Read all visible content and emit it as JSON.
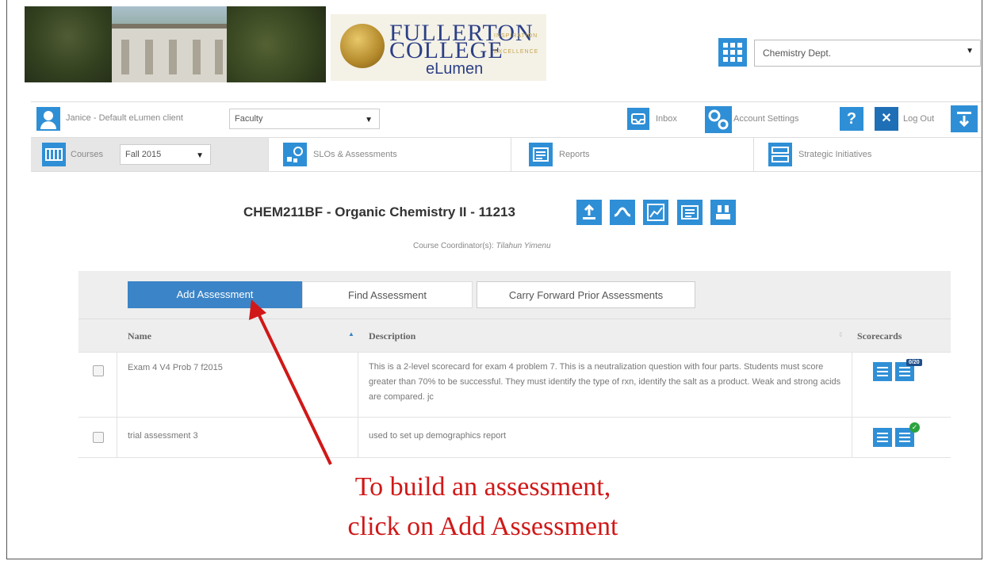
{
  "header": {
    "logo_line1": "FULLERTON",
    "logo_line2": "COLLEGE",
    "logo_tag1": "INSPIRATION",
    "logo_tag2": "EXCELLENCE",
    "logo_sub": "eLumen",
    "department": "Chemistry Dept."
  },
  "userbar": {
    "user_label": "Janice - Default eLumen client",
    "role": "Faculty",
    "inbox": "Inbox",
    "account_settings": "Account Settings",
    "help": "?",
    "logout_x": "✕",
    "logout": "Log Out"
  },
  "nav": {
    "courses": "Courses",
    "term": "Fall 2015",
    "slos": "SLOs & Assessments",
    "reports": "Reports",
    "strategic": "Strategic Initiatives"
  },
  "course": {
    "title": "CHEM211BF - Organic Chemistry II - 11213",
    "coordinator_label": "Course Coordinator(s): ",
    "coordinator_name": "Tilahun Yimenu"
  },
  "actions": {
    "add": "Add Assessment",
    "find": "Find Assessment",
    "carry": "Carry Forward Prior Assessments"
  },
  "table": {
    "columns": [
      "Name",
      "Description",
      "Scorecards"
    ],
    "rows": [
      {
        "name": "Exam 4 V4 Prob 7 f2015",
        "description": "This is a 2-level scorecard for exam 4 problem 7. This is a neutralization question with four parts. Students must score greater than 70% to be successful. They must identify the type of rxn, identify the salt as a product. Weak and strong acids are compared. jc",
        "badge": "0/20"
      },
      {
        "name": "trial assessment 3",
        "description": "used to set up demographics report",
        "badge": "✓"
      }
    ]
  },
  "annotation": {
    "line1": "To build an assessment,",
    "line2": "click on Add Assessment",
    "color": "#d01818"
  },
  "colors": {
    "accent": "#2f8fd6",
    "button": "#3b84c7"
  }
}
